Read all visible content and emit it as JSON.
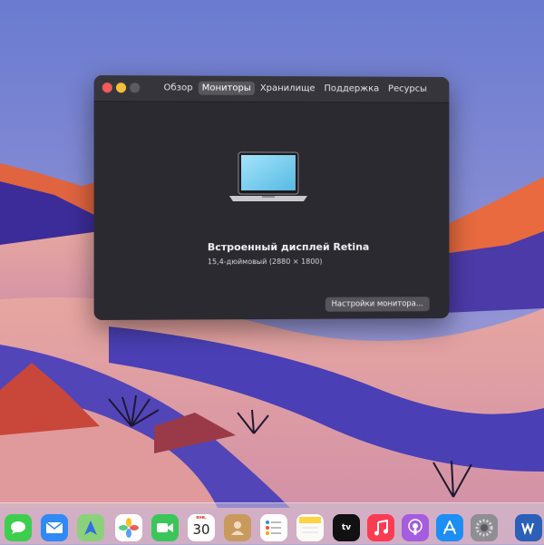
{
  "window": {
    "tabs": [
      {
        "label": "Обзор"
      },
      {
        "label": "Мониторы"
      },
      {
        "label": "Хранилище"
      },
      {
        "label": "Поддержка"
      },
      {
        "label": "Ресурсы"
      }
    ],
    "active_tab": "Мониторы",
    "display_name": "Встроенный дисплей Retina",
    "display_resolution": "15,4-дюймовый (2880 × 1800)",
    "settings_button": "Настройки монитора..."
  },
  "dock": {
    "calendar_month": "янв.",
    "calendar_day": "30",
    "tv_label": "tv",
    "items": [
      "messages-icon",
      "mail-icon",
      "maps-icon",
      "photos-icon",
      "facetime-icon",
      "calendar-icon",
      "contacts-icon",
      "reminders-icon",
      "notes-icon",
      "apple-tv-icon",
      "music-icon",
      "podcasts-icon",
      "app-store-icon",
      "system-preferences-icon",
      "word-icon"
    ]
  }
}
